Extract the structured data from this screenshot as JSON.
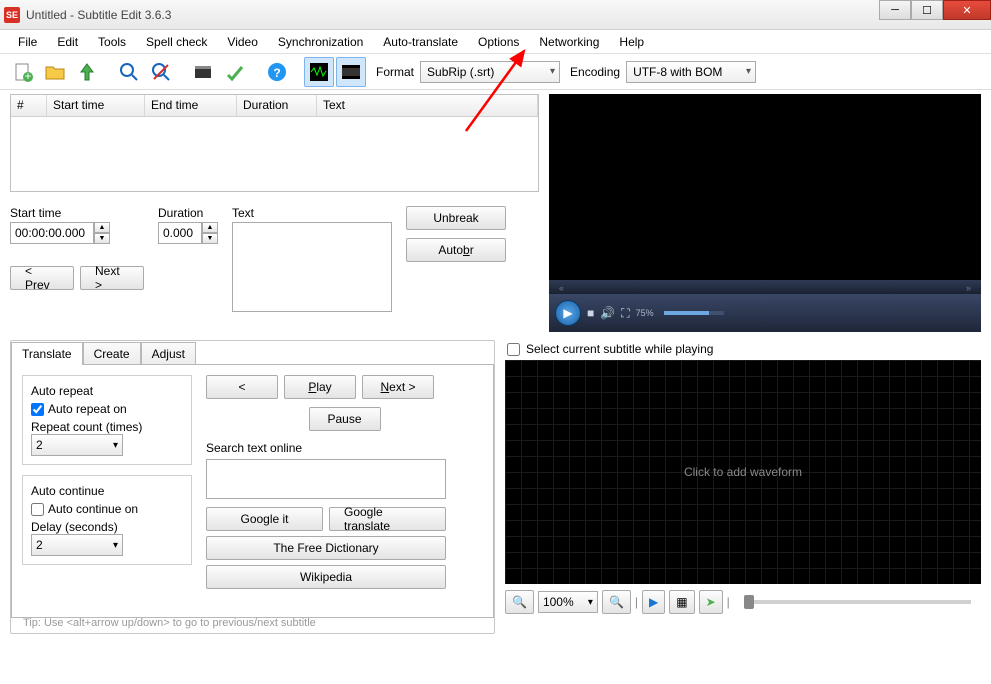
{
  "title": "Untitled - Subtitle Edit 3.6.3",
  "menu": [
    "File",
    "Edit",
    "Tools",
    "Spell check",
    "Video",
    "Synchronization",
    "Auto-translate",
    "Options",
    "Networking",
    "Help"
  ],
  "toolbar": {
    "format_label": "Format",
    "format_value": "SubRip (.srt)",
    "encoding_label": "Encoding",
    "encoding_value": "UTF-8 with BOM"
  },
  "grid": {
    "cols": [
      "#",
      "Start time",
      "End time",
      "Duration",
      "Text"
    ]
  },
  "edit": {
    "start_label": "Start time",
    "start_value": "00:00:00.000",
    "duration_label": "Duration",
    "duration_value": "0.000",
    "text_label": "Text",
    "unbreak": "Unbreak",
    "autobr_pre": "Auto ",
    "autobr_u": "b",
    "autobr_post": "r",
    "prev": "< Prev",
    "next": "Next >"
  },
  "video": {
    "volume_pct": "75%"
  },
  "tabs": {
    "translate": "Translate",
    "create": "Create",
    "adjust": "Adjust"
  },
  "translate": {
    "auto_repeat_title": "Auto repeat",
    "auto_repeat_on": "Auto repeat on",
    "repeat_count_label": "Repeat count (times)",
    "repeat_count_value": "2",
    "auto_continue_title": "Auto continue",
    "auto_continue_on": "Auto continue on",
    "delay_label": "Delay (seconds)",
    "delay_value": "2",
    "back": "<",
    "play_u": "P",
    "play_rest": "lay",
    "next_u": "N",
    "next_rest": "ext >",
    "pause": "Pause",
    "search_label": "Search text online",
    "google_it": "Google it",
    "google_translate": "Google translate",
    "free_dict": "The Free Dictionary",
    "wikipedia": "Wikipedia"
  },
  "tip": "Tip: Use <alt+arrow up/down> to go to previous/next subtitle",
  "wave": {
    "select_current": "Select current subtitle while playing",
    "placeholder": "Click to add waveform",
    "zoom": "100%"
  }
}
